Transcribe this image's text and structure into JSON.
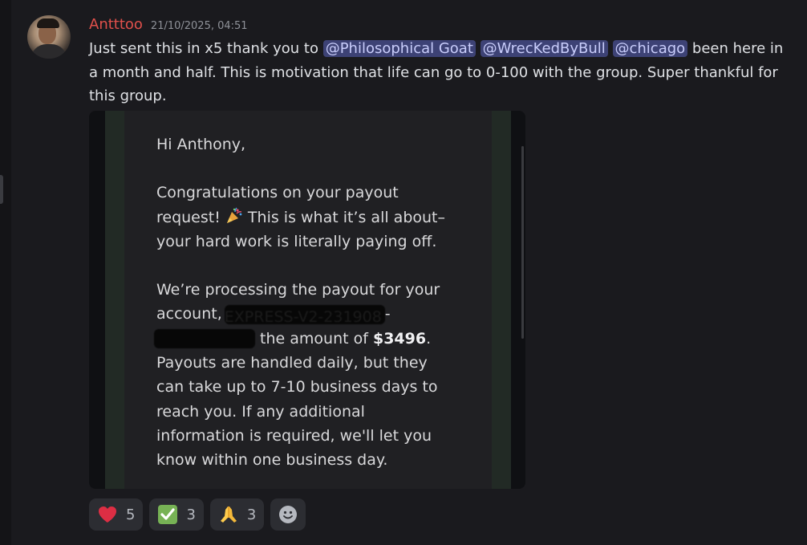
{
  "user": {
    "username": "Antttoo",
    "timestamp": "21/10/2025, 04:51"
  },
  "message": {
    "line1_pre": "Just sent this in x5 thank you to ",
    "mention1": "@Philosophical Goat",
    "mention2": "@WrecKedByBull",
    "mention3": "@chicago",
    "line1_post": " been here in",
    "line2": "a month and half. This is motivation that life can go to 0-100 with the group. Super thankful for",
    "line3": "this group."
  },
  "email": {
    "greeting": "Hi Anthony,",
    "p1_line1": "Congratulations on your payout",
    "p1_line2a": "request! ",
    "p1_line2b": " This is what it’s all about–",
    "p1_line3": "your hard work is literally paying off.",
    "p2_line1": "We’re processing the payout for your",
    "p2_line2_pre": "account, ",
    "p2_line2_redacted": "EXPRESS-V2-231908",
    "p2_line2_post": "-",
    "p2_line3_post": " the amount of ",
    "amount": "$3496",
    "p2_line3_end": ".",
    "p2_line4": "Payouts are handled daily, but they",
    "p2_line5": "can take up to 7-10 business days to",
    "p2_line6": "reach you. If any additional",
    "p2_line7": "information is required, we'll let you",
    "p2_line8": "know within one business day."
  },
  "reactions": [
    {
      "icon": "heart-icon",
      "count": "5"
    },
    {
      "icon": "check-mark-icon",
      "count": "3"
    },
    {
      "icon": "folded-hands-icon",
      "count": "3"
    }
  ],
  "colors": {
    "background": "#1a1a1e",
    "username": "#e0504b",
    "mention_bg": "#3d4275",
    "mention_text": "#c9cdfb",
    "reaction_bg": "#2c2d32"
  }
}
